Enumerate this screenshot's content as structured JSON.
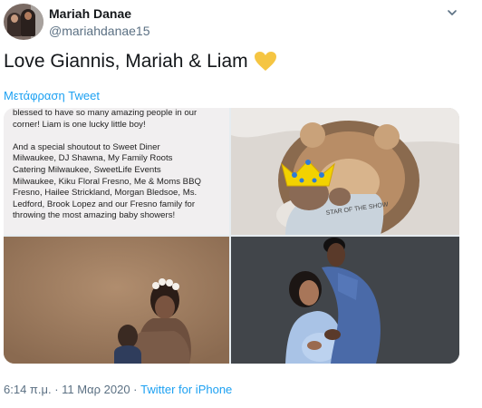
{
  "author": {
    "name": "Mariah Danae",
    "handle": "@mariahdanae15"
  },
  "tweet": {
    "text": "Love Giannis, Mariah & Liam",
    "translate_label": "Μετάφραση Tweet",
    "heart_color": "#f5c542"
  },
  "media": {
    "caption": "blessed to have so many amazing people in our\ncorner! Liam is one lucky little boy!\n\nAnd a special shoutout to Sweet Diner\nMilwaukee, DJ Shawna, My Family Roots\nCatering Milwaukee, SweetLife Events\nMilwaukee, Kiku Floral Fresno, Me & Moms BBQ\nFresno, Hailee Strickland, Morgan Bledsoe, Ms.\nLedford, Brook Lopez and our Fresno family for\nthrowing the most amazing baby showers!",
    "shirt_text": "STAR OF THE SHOW"
  },
  "footer": {
    "time": "6:14 π.μ.",
    "separator": " · ",
    "date": "11 Μαρ 2020",
    "source": "Twitter for iPhone"
  },
  "colors": {
    "link": "#1da1f2",
    "secondary": "#5b7083",
    "crown": "#f2d200"
  },
  "icons": {
    "menu": "chevron-down-icon",
    "heart": "yellow-heart-icon"
  }
}
